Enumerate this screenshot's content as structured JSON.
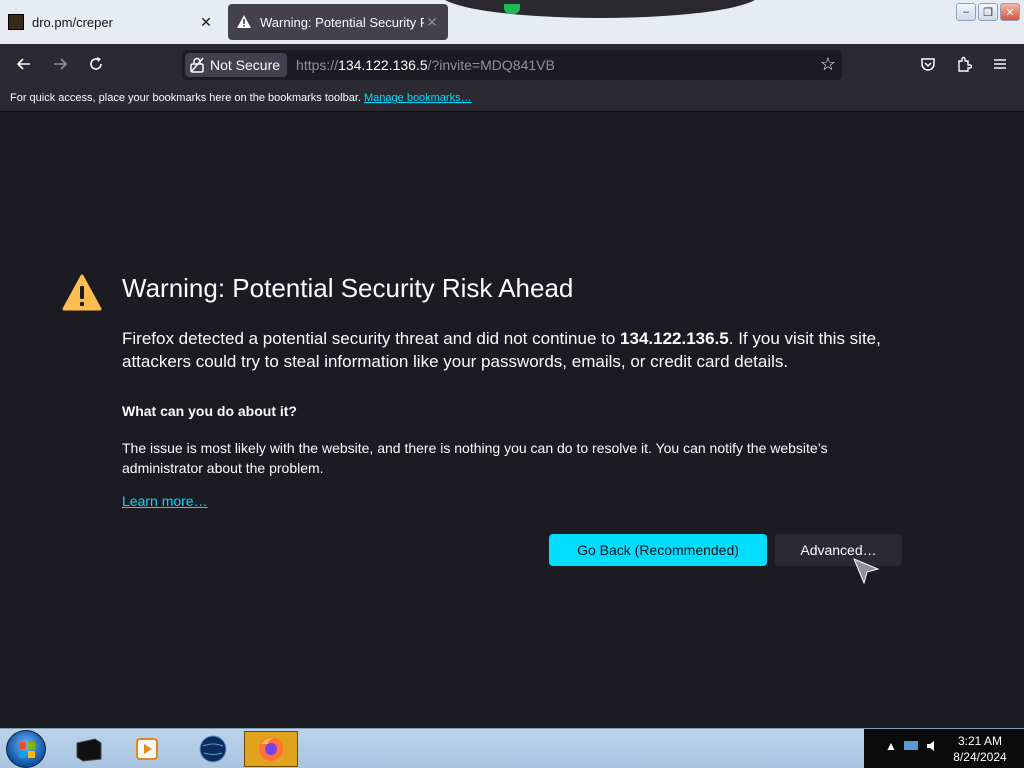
{
  "tabs": [
    {
      "title": "dro.pm/creper",
      "close": "✕"
    },
    {
      "title": "Warning: Potential Security Risk",
      "close": "✕"
    }
  ],
  "window_buttons": [
    "–",
    "❐",
    "✕"
  ],
  "nav": {
    "not_secure": "Not Secure",
    "url_scheme": "https://",
    "url_host": "134.122.136.5",
    "url_rest": "/?invite=MDQ841VB"
  },
  "bookmarks": {
    "text": "For quick access, place your bookmarks here on the bookmarks toolbar.",
    "link": "Manage bookmarks…"
  },
  "page": {
    "title": "Warning: Potential Security Risk Ahead",
    "desc_before": "Firefox detected a potential security threat and did not continue to ",
    "desc_host": "134.122.136.5",
    "desc_after": ". If you visit this site, attackers could try to steal information like your passwords, emails, or credit card details.",
    "subhead": "What can you do about it?",
    "body": "The issue is most likely with the website, and there is nothing you can do to resolve it. You can notify the website’s administrator about the problem.",
    "learn_more": "Learn more…",
    "go_back": "Go Back (Recommended)",
    "advanced": "Advanced…"
  },
  "taskbar": {
    "time": "3:21 AM",
    "date": "8/24/2024"
  },
  "colors": {
    "accent": "#00ddff",
    "warning": "#ffbd4f",
    "background": "#1c1b22"
  }
}
